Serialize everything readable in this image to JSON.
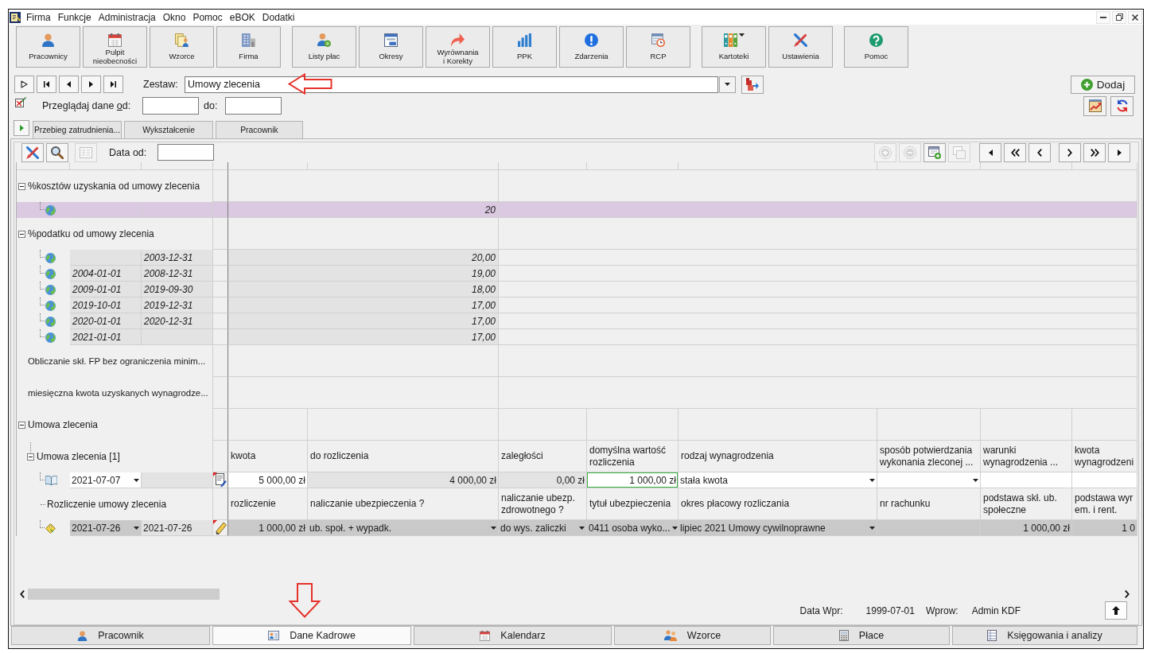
{
  "menu_bar": {
    "items": [
      "Firma",
      "Funkcje",
      "Administracja",
      "Okno",
      "Pomoc",
      "eBOK",
      "Dodatki"
    ]
  },
  "toolbar": {
    "groups": [
      [
        {
          "label": "Pracownicy",
          "dropdown": false
        },
        {
          "label": "Pulpit\nnieobecności",
          "dropdown": false
        },
        {
          "label": "Wzorce",
          "dropdown": false
        },
        {
          "label": "Firma",
          "dropdown": false
        }
      ],
      [
        {
          "label": "Listy płac",
          "dropdown": false
        },
        {
          "label": "Okresy",
          "dropdown": false
        },
        {
          "label": "Wyrównania\ni Korekty",
          "dropdown": false
        },
        {
          "label": "PPK",
          "dropdown": false
        },
        {
          "label": "Zdarzenia",
          "dropdown": false
        },
        {
          "label": "RCP",
          "dropdown": false
        }
      ],
      [
        {
          "label": "Kartoteki",
          "dropdown": true
        },
        {
          "label": "Ustawienia",
          "dropdown": false
        }
      ],
      [
        {
          "label": "Pomoc",
          "dropdown": false
        }
      ]
    ]
  },
  "set_selector": {
    "label": "Zestaw:",
    "value": "Umowy zlecenia",
    "callout_arrow": true
  },
  "add_button": {
    "label": "Dodaj"
  },
  "date_filter": {
    "label_parts": [
      "Przeglądaj dane ",
      "o",
      "d:"
    ],
    "to_label": "do:"
  },
  "tabs": [
    {
      "label": "Przebieg zatrudnienia...",
      "selected": false
    },
    {
      "label": "Wykształcenie",
      "selected": false
    },
    {
      "label": "Pracownik",
      "selected": false
    }
  ],
  "panel": {
    "toolbar": {
      "left_buttons": [
        {
          "disabled": false
        },
        {
          "disabled": false
        },
        {
          "disabled": true
        }
      ],
      "date_label": "Data od:",
      "right_buttons": [
        {
          "disabled": true
        },
        {
          "disabled": true
        },
        {
          "disabled": false
        },
        {
          "disabled": true
        }
      ]
    },
    "grid": {
      "nodes": [
        {
          "kind": "group",
          "label": "%kosztów uzyskania od umowy zlecenia",
          "expanded": true,
          "children": [
            {
              "kind": "entry",
              "value": "20",
              "selected": true
            }
          ]
        },
        {
          "kind": "group",
          "label": "%podatku od umowy zlecenia",
          "expanded": true,
          "children": [
            {
              "kind": "entry",
              "to": "2003-12-31",
              "value": "20,00",
              "selected": false
            },
            {
              "kind": "entry",
              "from": "2004-01-01",
              "to": "2008-12-31",
              "value": "19,00",
              "selected": false
            },
            {
              "kind": "entry",
              "from": "2009-01-01",
              "to": "2019-09-30",
              "value": "18,00",
              "selected": false
            },
            {
              "kind": "entry",
              "from": "2019-10-01",
              "to": "2019-12-31",
              "value": "17,00",
              "selected": false
            },
            {
              "kind": "entry",
              "from": "2020-01-01",
              "to": "2020-12-31",
              "value": "17,00",
              "selected": false
            },
            {
              "kind": "entry",
              "from": "2021-01-01",
              "value": "17,00",
              "selected": false
            }
          ]
        },
        {
          "kind": "field",
          "label": "Obliczanie skł. FP bez ograniczenia minim..."
        },
        {
          "kind": "field",
          "label": "miesięczna kwota uzyskanych wynagrodze..."
        },
        {
          "kind": "group",
          "label": "Umowa zlecenia",
          "expanded": true,
          "children": [
            {
              "kind": "record",
              "label": "Umowa zlecenia [1]",
              "expanded": true,
              "headers": [
                "kwota",
                "do rozliczenia",
                "zaległości",
                "domyślna wartość rozliczenia",
                "rodzaj wynagrodzenia",
                "sposób potwierdzania wykonania zleconej ...",
                "warunki wynagrodzenia ...",
                "kwota wynagrodzeni"
              ],
              "row": {
                "kind": "contract",
                "highlighted": false,
                "note": true,
                "cells": [
                  {
                    "kind": "combo",
                    "text": "2021-07-07",
                    "editable": true,
                    "focused": false
                  },
                  {
                    "kind": "text",
                    "editable": false,
                    "focused": false
                  },
                  {
                    "kind": "amount",
                    "text": "5 000,00 zł",
                    "editable": true,
                    "focused": false
                  },
                  {
                    "kind": "amount",
                    "text": "4 000,00 zł",
                    "editable": false,
                    "focused": false
                  },
                  {
                    "kind": "amount",
                    "text": "0,00 zł",
                    "editable": false,
                    "focused": false
                  },
                  {
                    "kind": "amount",
                    "text": "1 000,00 zł",
                    "editable": true,
                    "focused": true
                  },
                  {
                    "kind": "combo",
                    "text": "stała kwota",
                    "editable": true,
                    "focused": false
                  },
                  {
                    "kind": "combo",
                    "editable": true,
                    "focused": false
                  },
                  {
                    "kind": "text",
                    "editable": true,
                    "focused": false
                  },
                  {
                    "kind": "text",
                    "editable": true,
                    "focused": false
                  }
                ]
              },
              "children": [
                {
                  "kind": "record",
                  "label": "Rozliczenie umowy zlecenia",
                  "headers": [
                    "rozliczenie",
                    "naliczanie ubezpieczenia ?",
                    "naliczanie ubezp. zdrowotnego ?",
                    "tytuł ubezpieczenia",
                    "okres płacowy rozliczania",
                    "nr rachunku",
                    "podstawa skł. ub. społeczne",
                    "podstawa wyr\nem. i rent."
                  ],
                  "row": {
                    "kind": "settlement",
                    "highlighted": true,
                    "note": true,
                    "cells": [
                      {
                        "kind": "combo",
                        "text": "2021-07-26",
                        "editable": true,
                        "focused": false
                      },
                      {
                        "kind": "text",
                        "text": "2021-07-26",
                        "editable": false,
                        "focused": false
                      },
                      {
                        "kind": "amount",
                        "text": "1 000,00 zł",
                        "editable": true,
                        "focused": false
                      },
                      {
                        "kind": "combo",
                        "text": "ub. społ. + wypadk.",
                        "editable": true,
                        "focused": false
                      },
                      {
                        "kind": "combo",
                        "text": "do wys. zaliczki",
                        "editable": true,
                        "focused": false
                      },
                      {
                        "kind": "combo",
                        "text": "0411 osoba wyko...",
                        "editable": true,
                        "focused": false
                      },
                      {
                        "kind": "combo",
                        "text": "lipiec 2021 Umowy cywilnoprawne",
                        "editable": true,
                        "focused": false
                      },
                      {
                        "kind": "text",
                        "editable": true,
                        "focused": false
                      },
                      {
                        "kind": "amount",
                        "text": "1 000,00 zł",
                        "editable": true,
                        "focused": false
                      },
                      {
                        "kind": "amount",
                        "text": "1 0",
                        "editable": true,
                        "focused": false
                      }
                    ]
                  }
                }
              ]
            }
          ]
        }
      ]
    },
    "status": {
      "date_label": "Data Wpr:",
      "date": "1999-07-01",
      "author_label": "Wprow:",
      "author": "Admin KDF"
    }
  },
  "bottom_tabs": [
    {
      "label": "Pracownik",
      "selected": false
    },
    {
      "label": "Dane Kadrowe",
      "selected": true,
      "callout_arrow": true
    },
    {
      "label": "Kalendarz",
      "selected": false
    },
    {
      "label": "Wzorce",
      "selected": false
    },
    {
      "label": "Płace",
      "selected": false
    },
    {
      "label": "Księgowania i analizy",
      "selected": false
    }
  ]
}
